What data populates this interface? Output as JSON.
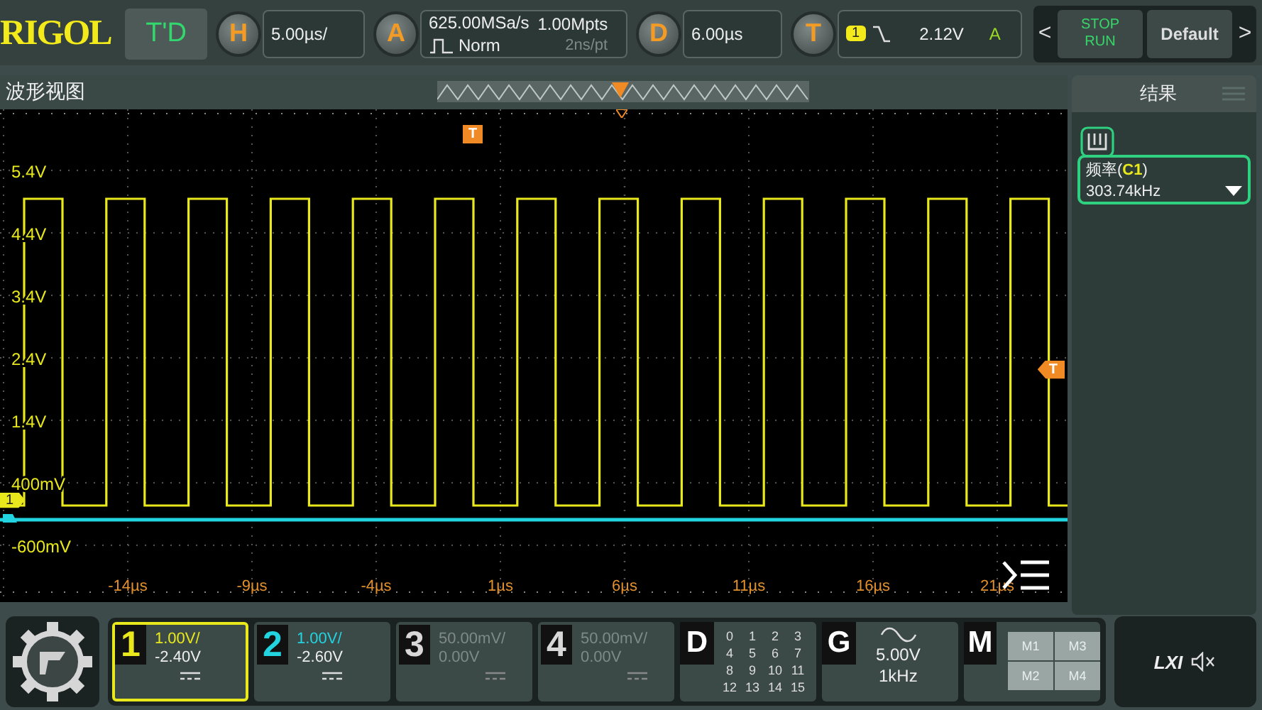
{
  "top_bar": {
    "logo": "RIGOL",
    "mode": "T'D",
    "horizontal": {
      "key": "H",
      "value": "5.00µs/"
    },
    "acquire": {
      "key": "A",
      "sample_rate": "625.00MSa/s",
      "mode": "Norm",
      "depth": "1.00Mpts",
      "resolution": "2ns/pt"
    },
    "delay": {
      "key": "D",
      "value": "6.00µs"
    },
    "trigger": {
      "key": "T",
      "source": "1",
      "level": "2.12V",
      "mode": "A"
    },
    "prev": "<",
    "stop": "STOP",
    "run": "RUN",
    "default_button": "Default",
    "next": ">"
  },
  "waveform_view": {
    "title": "波形视图",
    "y_labels": [
      "5.4V",
      "4.4V",
      "3.4V",
      "2.4V",
      "1.4V",
      "400mV",
      "-600mV"
    ],
    "x_labels": [
      "-14µs",
      "-9µs",
      "-4µs",
      "1µs",
      "6µs",
      "11µs",
      "16µs",
      "21µs"
    ],
    "trigger_position_marker": "T",
    "trigger_level_marker": "T",
    "channel_marker": "1"
  },
  "results": {
    "title": "结果",
    "measurement": {
      "name": "频率(**C1**)",
      "value": "303.74kHz"
    }
  },
  "channels": [
    {
      "number": "1",
      "scale": "1.00V/",
      "offset": "-2.40V",
      "selected": true,
      "enabled": true
    },
    {
      "number": "2",
      "scale": "1.00V/",
      "offset": "-2.60V",
      "selected": false,
      "enabled": true
    },
    {
      "number": "3",
      "scale": "50.00mV/",
      "offset": "0.00V",
      "selected": false,
      "enabled": false
    },
    {
      "number": "4",
      "scale": "50.00mV/",
      "offset": "0.00V",
      "selected": false,
      "enabled": false
    }
  ],
  "digital": {
    "key": "D",
    "bits": [
      "0",
      "1",
      "2",
      "3",
      "4",
      "5",
      "6",
      "7",
      "8",
      "9",
      "10",
      "11",
      "12",
      "13",
      "14",
      "15"
    ]
  },
  "generator": {
    "key": "G",
    "amplitude": "5.00V",
    "frequency": "1kHz"
  },
  "math": {
    "key": "M",
    "slots": [
      "M1",
      "M3",
      "M2",
      "M4"
    ]
  },
  "status": {
    "lxi": "LXI"
  }
}
